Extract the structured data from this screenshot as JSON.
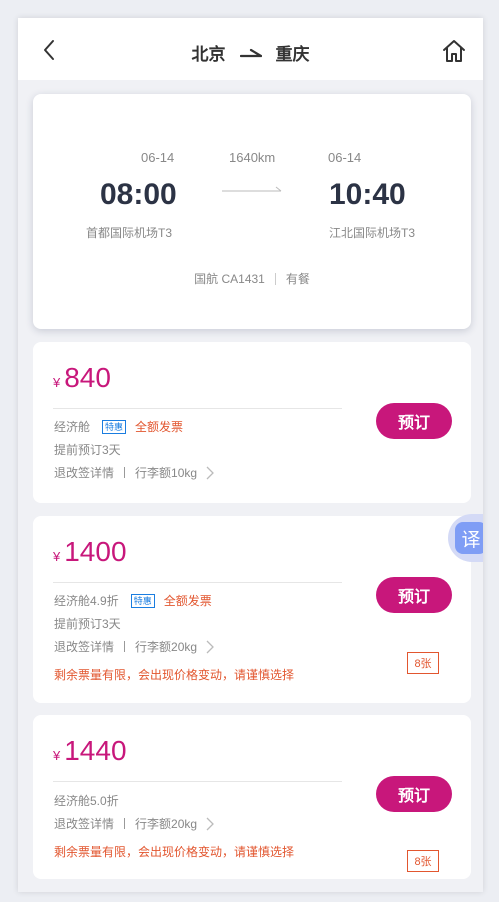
{
  "header": {
    "from_city": "北京",
    "to_city": "重庆"
  },
  "flight": {
    "dep_date": "06-14",
    "arr_date": "06-14",
    "distance": "1640km",
    "dep_time": "08:00",
    "arr_time": "10:40",
    "dep_airport": "首都国际机场T3",
    "arr_airport": "江北国际机场T3",
    "airline_flight": "国航 CA1431",
    "meal": "有餐"
  },
  "fares": [
    {
      "currency": "¥",
      "price": "840",
      "cabin": "经济舱",
      "special_badge": "特惠",
      "invoice": "全额发票",
      "advance": "提前预订3天",
      "refund_label": "退改签详情",
      "baggage": "行李额10kg",
      "book_label": "预订"
    },
    {
      "currency": "¥",
      "price": "1400",
      "cabin": "经济舱4.9折",
      "special_badge": "特惠",
      "invoice": "全额发票",
      "advance": "提前预订3天",
      "refund_label": "退改签详情",
      "baggage": "行李额20kg",
      "warning": "剩余票量有限，会出现价格变动，请谨慎选择",
      "tickets_left": "8张",
      "book_label": "预订"
    },
    {
      "currency": "¥",
      "price": "1440",
      "cabin": "经济舱5.0折",
      "refund_label": "退改签详情",
      "baggage": "行李额20kg",
      "warning": "剩余票量有限，会出现价格变动，请谨慎选择",
      "tickets_left": "8张",
      "book_label": "预订"
    }
  ],
  "translate_label": "译",
  "colors": {
    "accent": "#c8177b",
    "warning": "#e2562f",
    "badge_blue": "#1a7de0",
    "translate_bg": "#7f9df5"
  },
  "icons": [
    "back-icon",
    "home-icon",
    "route-arrow-icon",
    "flight-arrow-icon",
    "chevron-right-icon",
    "translate-icon"
  ]
}
